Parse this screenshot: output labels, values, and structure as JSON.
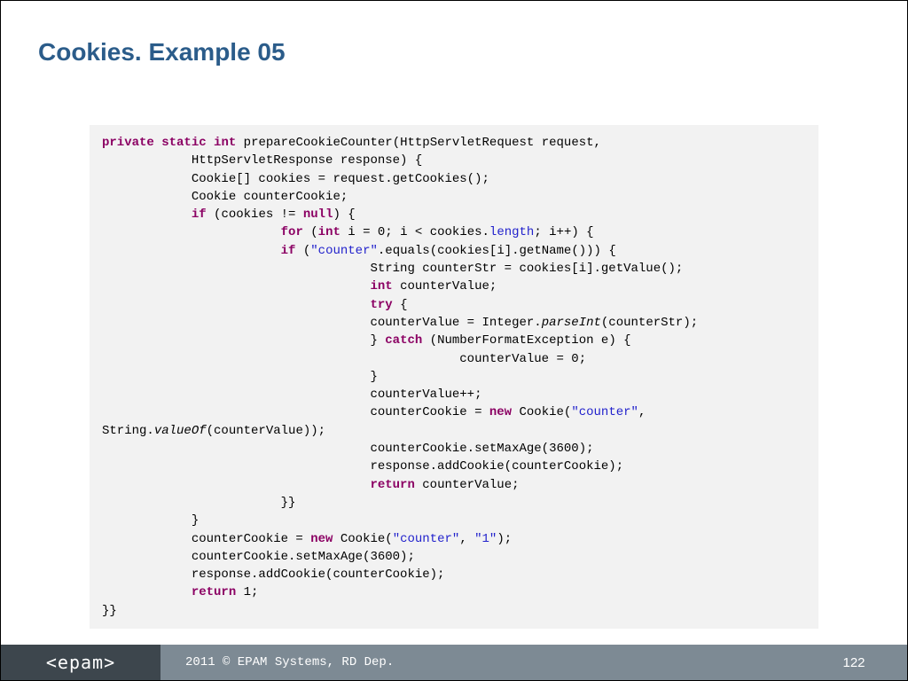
{
  "title": "Cookies. Example 05",
  "footer": {
    "brand": "<epam>",
    "copyright": "2011 © EPAM Systems, RD Dep.",
    "page": "122"
  },
  "code": {
    "l01a": "private",
    "l01b": "static",
    "l01c": "int",
    "l01d": " prepareCookieCounter(HttpServletRequest request,",
    "l02": "            HttpServletResponse response) {",
    "l03": "            Cookie[] cookies = request.getCookies();",
    "l04": "            Cookie counterCookie;",
    "l05a": "            ",
    "l05b": "if",
    "l05c": " (cookies != ",
    "l05d": "null",
    "l05e": ") {",
    "l06a": "                        ",
    "l06b": "for",
    "l06c": " (",
    "l06d": "int",
    "l06e": " i = 0; i < cookies.",
    "l06f": "length",
    "l06g": "; i++) {",
    "l07a": "                        ",
    "l07b": "if",
    "l07c": " (",
    "l07d": "\"counter\"",
    "l07e": ".equals(cookies[i].getName())) {",
    "l08": "                                    String counterStr = cookies[i].getValue();",
    "l09a": "                                    ",
    "l09b": "int",
    "l09c": " counterValue;",
    "l10a": "                                    ",
    "l10b": "try",
    "l10c": " {",
    "l11a": "                                    counterValue = Integer.",
    "l11b": "parseInt",
    "l11c": "(counterStr);",
    "l12a": "                                    } ",
    "l12b": "catch",
    "l12c": " (NumberFormatException e) {",
    "l13": "                                                counterValue = 0;",
    "l14": "                                    }",
    "l15": "                                    counterValue++;",
    "l16a": "                                    counterCookie = ",
    "l16b": "new",
    "l16c": " Cookie(",
    "l16d": "\"counter\"",
    "l16e": ",",
    "l17a": "String.",
    "l17b": "valueOf",
    "l17c": "(counterValue));",
    "l18": "                                    counterCookie.setMaxAge(3600);",
    "l19": "                                    response.addCookie(counterCookie);",
    "l20a": "                                    ",
    "l20b": "return",
    "l20c": " counterValue;",
    "l21": "                        }}",
    "l22": "            }",
    "l23a": "            counterCookie = ",
    "l23b": "new",
    "l23c": " Cookie(",
    "l23d": "\"counter\"",
    "l23e": ", ",
    "l23f": "\"1\"",
    "l23g": ");",
    "l24": "            counterCookie.setMaxAge(3600);",
    "l25": "            response.addCookie(counterCookie);",
    "l26a": "            ",
    "l26b": "return",
    "l26c": " 1;",
    "l27": "}}"
  }
}
